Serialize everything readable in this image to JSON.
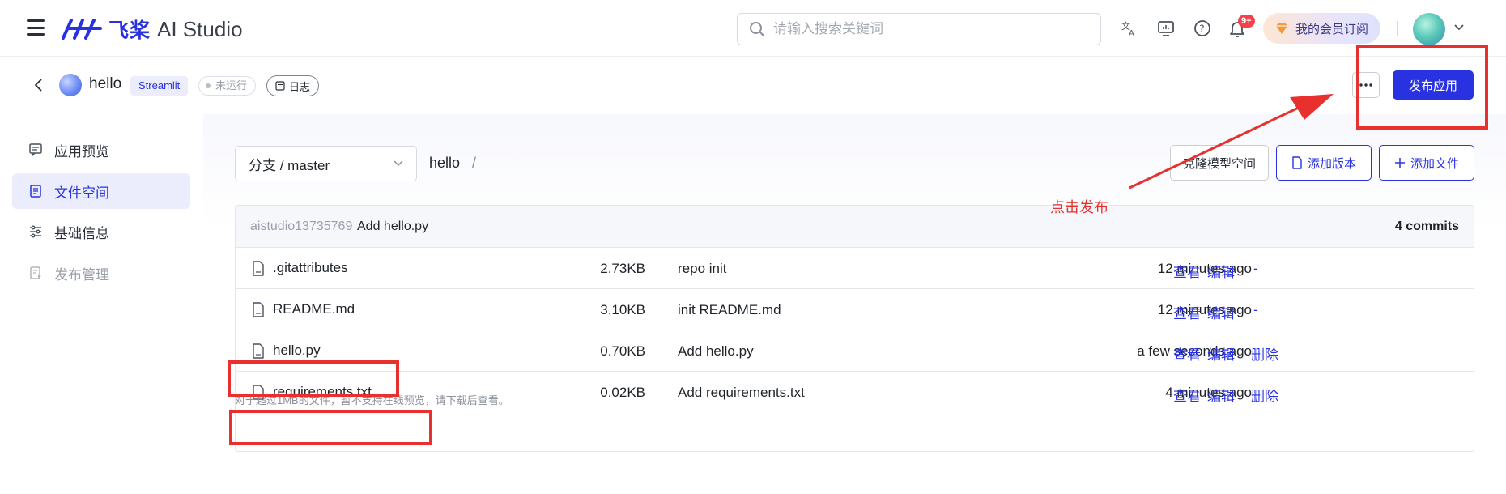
{
  "topbar": {
    "logo_cn": "飞桨",
    "logo_en": "AI Studio",
    "search_placeholder": "请输入搜索关键词",
    "notification_badge": "9+",
    "vip_label": "我的会员订阅"
  },
  "subbar": {
    "project_name": "hello",
    "framework_tag": "Streamlit",
    "status_tag": "未运行",
    "log_label": "日志",
    "more_label": "···",
    "publish_label": "发布应用"
  },
  "sidebar": {
    "items": [
      {
        "label": "应用预览"
      },
      {
        "label": "文件空间"
      },
      {
        "label": "基础信息"
      },
      {
        "label": "发布管理"
      }
    ]
  },
  "main": {
    "branch_label": "分支 / master",
    "breadcrumb_repo": "hello",
    "breadcrumb_sep": "/",
    "clone_label": "克隆模型空间",
    "add_version_label": "添加版本",
    "add_file_label": "添加文件",
    "last_commit": {
      "user": "aistudio13735769",
      "message": "Add hello.py",
      "count": "4 commits"
    },
    "files": [
      {
        "name": ".gitattributes",
        "size": "2.73KB",
        "message": "repo init",
        "time": "12 minutes ago",
        "view": "查看",
        "edit": "编辑",
        "delete": "-"
      },
      {
        "name": "README.md",
        "size": "3.10KB",
        "message": "init README.md",
        "time": "12 minutes ago",
        "view": "查看",
        "edit": "编辑",
        "delete": "-"
      },
      {
        "name": "hello.py",
        "size": "0.70KB",
        "message": "Add hello.py",
        "time": "a few seconds ago",
        "view": "查看",
        "edit": "编辑",
        "delete": "删除"
      },
      {
        "name": "requirements.txt",
        "size": "0.02KB",
        "message": "Add requirements.txt",
        "time": "4 minutes ago",
        "view": "查看",
        "edit": "编辑",
        "delete": "删除"
      }
    ],
    "note": "对于超过1MB的文件，暂不支持在线预览，请下载后查看。"
  },
  "annotation": {
    "text": "点击发布",
    "color": "#e8312f"
  },
  "colors": {
    "primary": "#2932e1",
    "annotation_red": "#e8312f"
  }
}
